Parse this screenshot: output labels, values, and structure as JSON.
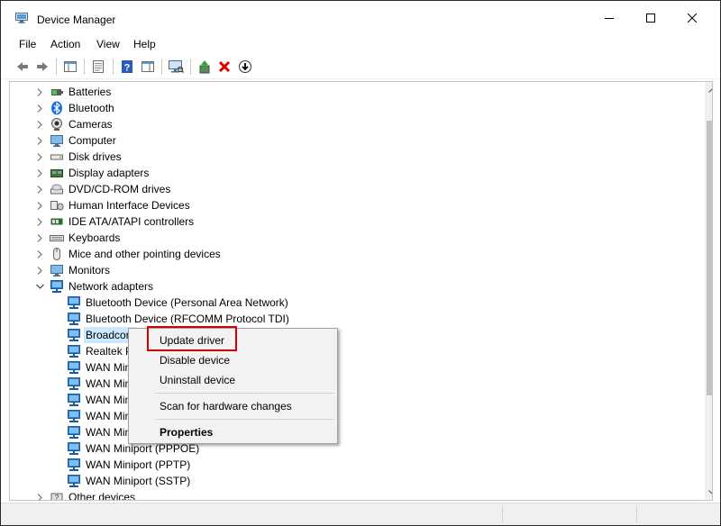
{
  "window": {
    "title": "Device Manager"
  },
  "menubar": [
    "File",
    "Action",
    "View",
    "Help"
  ],
  "toolbar": {
    "icons": [
      "back-arrow-icon",
      "forward-arrow-icon",
      "show-hide-console-tree-icon",
      "properties-icon",
      "help-icon",
      "action-pane-icon",
      "monitor-scan-icon",
      "update-driver-icon",
      "uninstall-device-icon",
      "download-driver-icon"
    ]
  },
  "tree": {
    "rows": [
      {
        "label": "Batteries",
        "icon": "battery-icon",
        "expanded": false,
        "level": 0
      },
      {
        "label": "Bluetooth",
        "icon": "bluetooth-icon",
        "expanded": false,
        "level": 0
      },
      {
        "label": "Cameras",
        "icon": "camera-icon",
        "expanded": false,
        "level": 0
      },
      {
        "label": "Computer",
        "icon": "computer-icon",
        "expanded": false,
        "level": 0
      },
      {
        "label": "Disk drives",
        "icon": "disk-drive-icon",
        "expanded": false,
        "level": 0
      },
      {
        "label": "Display adapters",
        "icon": "display-adapter-icon",
        "expanded": false,
        "level": 0
      },
      {
        "label": "DVD/CD-ROM drives",
        "icon": "dvd-drive-icon",
        "expanded": false,
        "level": 0
      },
      {
        "label": "Human Interface Devices",
        "icon": "hid-icon",
        "expanded": false,
        "level": 0
      },
      {
        "label": "IDE ATA/ATAPI controllers",
        "icon": "ide-controller-icon",
        "expanded": false,
        "level": 0
      },
      {
        "label": "Keyboards",
        "icon": "keyboard-icon",
        "expanded": false,
        "level": 0
      },
      {
        "label": "Mice and other pointing devices",
        "icon": "mouse-icon",
        "expanded": false,
        "level": 0
      },
      {
        "label": "Monitors",
        "icon": "monitor-icon",
        "expanded": false,
        "level": 0
      },
      {
        "label": "Network adapters",
        "icon": "network-adapter-icon",
        "expanded": true,
        "level": 0
      },
      {
        "label": "Bluetooth Device (Personal Area Network)",
        "icon": "network-adapter-icon",
        "level": 1
      },
      {
        "label": "Bluetooth Device (RFCOMM Protocol TDI)",
        "icon": "network-adapter-icon",
        "level": 1
      },
      {
        "label": "Broadcom",
        "icon": "network-adapter-icon",
        "level": 1,
        "selected": true
      },
      {
        "label": "Realtek P",
        "icon": "network-adapter-icon",
        "level": 1
      },
      {
        "label": "WAN Mini",
        "icon": "network-adapter-icon",
        "level": 1
      },
      {
        "label": "WAN Mini",
        "icon": "network-adapter-icon",
        "level": 1
      },
      {
        "label": "WAN Mini",
        "icon": "network-adapter-icon",
        "level": 1
      },
      {
        "label": "WAN Mini",
        "icon": "network-adapter-icon",
        "level": 1
      },
      {
        "label": "WAN Mini",
        "icon": "network-adapter-icon",
        "level": 1
      },
      {
        "label": "WAN Miniport (PPPOE)",
        "icon": "network-adapter-icon",
        "level": 1
      },
      {
        "label": "WAN Miniport (PPTP)",
        "icon": "network-adapter-icon",
        "level": 1
      },
      {
        "label": "WAN Miniport (SSTP)",
        "icon": "network-adapter-icon",
        "level": 1
      },
      {
        "label": "Other devices",
        "icon": "other-devices-icon",
        "expanded": false,
        "level": 0
      }
    ]
  },
  "context_menu": {
    "items": [
      {
        "label": "Update driver",
        "bold": false,
        "highlighted": true
      },
      {
        "label": "Disable device",
        "bold": false
      },
      {
        "label": "Uninstall device",
        "bold": false
      },
      {
        "label": "Scan for hardware changes",
        "bold": false
      },
      {
        "label": "Properties",
        "bold": true
      }
    ]
  },
  "colors": {
    "highlight_outline": "#d40000",
    "selection_bg": "#cce8ff",
    "network_icon": "#2f7fd1"
  }
}
